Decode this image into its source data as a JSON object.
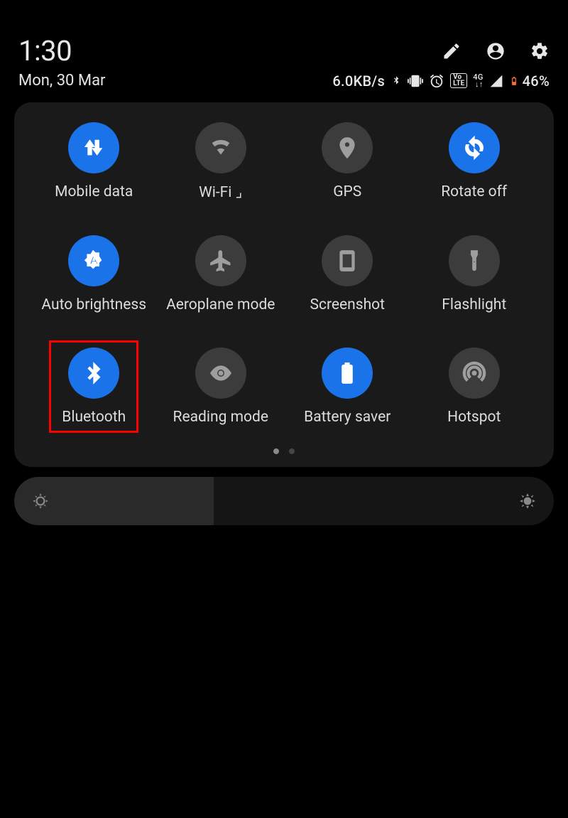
{
  "header": {
    "time": "1:30",
    "date": "Mon, 30 Mar",
    "icons": {
      "edit": "edit-icon",
      "account": "account-icon",
      "settings": "settings-icon"
    }
  },
  "status": {
    "speed": "6.0KB/s",
    "bluetooth_icon": "bluetooth-icon",
    "vibrate_icon": "vibrate-icon",
    "alarm_icon": "alarm-icon",
    "volte_label": "Vo\nLTE",
    "network_label": "4G",
    "battery_pct": "46%"
  },
  "tiles": [
    {
      "id": "mobile-data",
      "label": "Mobile data",
      "state": "on",
      "icon": "data-arrows-icon"
    },
    {
      "id": "wifi",
      "label": "Wi-Fi",
      "state": "off",
      "icon": "wifi-icon",
      "disconnected": true
    },
    {
      "id": "gps",
      "label": "GPS",
      "state": "off",
      "icon": "location-icon"
    },
    {
      "id": "rotate",
      "label": "Rotate off",
      "state": "on",
      "icon": "rotate-icon"
    },
    {
      "id": "auto-brightness",
      "label": "Auto brightness",
      "state": "on",
      "icon": "brightness-auto-icon"
    },
    {
      "id": "aeroplane",
      "label": "Aeroplane mode",
      "state": "off",
      "icon": "airplane-icon"
    },
    {
      "id": "screenshot",
      "label": "Screenshot",
      "state": "off",
      "icon": "phone-frame-icon"
    },
    {
      "id": "flashlight",
      "label": "Flashlight",
      "state": "off",
      "icon": "torch-icon"
    },
    {
      "id": "bluetooth",
      "label": "Bluetooth",
      "state": "on",
      "icon": "bluetooth-icon",
      "highlight": true
    },
    {
      "id": "reading",
      "label": "Reading mode",
      "state": "off",
      "icon": "eye-icon"
    },
    {
      "id": "battery-saver",
      "label": "Battery saver",
      "state": "on",
      "icon": "battery-plus-icon"
    },
    {
      "id": "hotspot",
      "label": "Hotspot",
      "state": "off",
      "icon": "hotspot-icon"
    }
  ],
  "pager": {
    "current": 0,
    "count": 2
  },
  "brightness": {
    "percent": 37
  }
}
